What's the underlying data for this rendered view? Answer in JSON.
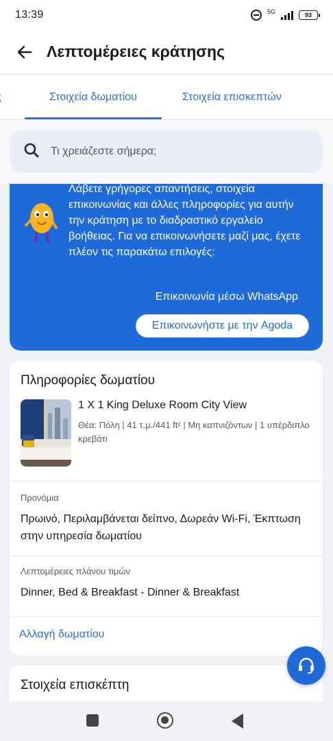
{
  "status_bar": {
    "time": "13:39",
    "network": "5G",
    "battery": "93"
  },
  "header": {
    "title": "Λεπτομέρειες κράτησης"
  },
  "tabs": [
    {
      "label": "ς"
    },
    {
      "label": "Στοιχεία δωματίου"
    },
    {
      "label": "Στοιχεία επισκεπτών"
    }
  ],
  "search": {
    "placeholder": "Τι χρειάζεστε σήμερα;"
  },
  "promo": {
    "text": "Λάβετε γρήγορες απαντήσεις, στοιχεία επικοινωνίας και άλλες πληροφορίες για αυτήν την κράτηση με το διαδραστικό εργαλείο βοήθειας. Για να επικοινωνήσετε μαζί μας, έχετε πλέον τις παρακάτω επιλογές:",
    "whatsapp_link": "Επικοινωνία μέσω WhatsApp",
    "agoda_button": "Επικοινωνήστε με την Agoda"
  },
  "room_card": {
    "title": "Πληροφορίες δωματίου",
    "room_name": "1 X 1 King Deluxe Room City View",
    "room_details": "Θέα: Πόλη | 41 τ.μ./441 ft² | Μη καπνιζόντων | 1 υπέρδιπλο κρεβάτι",
    "benefits_label": "Προνόμια",
    "benefits_value": "Πρωινό, Περιλαμβάνεται δείπνο, Δωρεάν Wi-Fi, Έκπτωση στην υπηρεσία δωματίου",
    "rate_plan_label": "Λεπτομέρειες πλάνου τιμών",
    "rate_plan_value": "Dinner, Bed & Breakfast - Dinner & Breakfast",
    "change_room": "Αλλαγή δωματίου"
  },
  "guest_card": {
    "title": "Στοιχεία επισκέπτη"
  },
  "colors": {
    "accent": "#1f6ad9",
    "link": "#2a6fd6"
  }
}
